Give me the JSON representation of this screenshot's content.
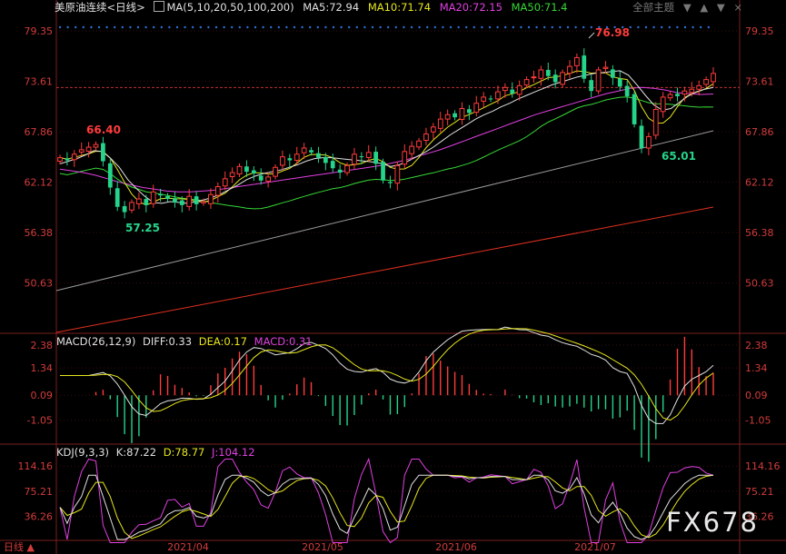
{
  "header": {
    "symbol": "美原油连续",
    "period": "<日线>",
    "ma_label": "MA(5,10,20,50,100,200)",
    "ma_values": [
      {
        "text": "MA5:72.94",
        "color": "#e0e0e0"
      },
      {
        "text": "MA10:71.74",
        "color": "#e6e61e"
      },
      {
        "text": "MA20:72.15",
        "color": "#e040e0"
      },
      {
        "text": "MA50:71.4",
        "color": "#36d836"
      }
    ],
    "controls": [
      "全部主题",
      "▼",
      "▲",
      "▼",
      "×"
    ]
  },
  "macd_header": {
    "label": "MACD(26,12,9)",
    "values": [
      {
        "text": "DIFF:0.33",
        "color": "#e0e0e0"
      },
      {
        "text": "DEA:0.17",
        "color": "#e6e61e"
      },
      {
        "text": "MACD:0.31",
        "color": "#e040e0"
      }
    ]
  },
  "kdj_header": {
    "label": "KDJ(9,3,3)",
    "values": [
      {
        "text": "K:87.22",
        "color": "#e0e0e0"
      },
      {
        "text": "D:78.77",
        "color": "#e6e61e"
      },
      {
        "text": "J:104.12",
        "color": "#e040e0"
      }
    ]
  },
  "price_axis": [
    "79.35",
    "73.61",
    "67.86",
    "62.12",
    "56.38",
    "50.63"
  ],
  "macd_axis": [
    "2.38",
    "1.34",
    "0.09",
    "-1.05"
  ],
  "kdj_axis": [
    "114.16",
    "75.21",
    "36.26"
  ],
  "x_axis": [
    "2021/04",
    "2021/05",
    "2021/06",
    "2021/07"
  ],
  "annotations": {
    "high": "76.98",
    "swing_high": "66.40",
    "low1": "57.25",
    "low2": "65.01"
  },
  "last_price": "73.61",
  "footer_label": "日线",
  "watermark": "FX678",
  "colors": {
    "up": "#ff3b3b",
    "down": "#25d48a",
    "bg": "#000000",
    "axis": "#d43b3b"
  },
  "chart_data": {
    "type": "candlestick",
    "title": "美原油连续 <日线>",
    "x_labels": [
      "2021/04",
      "2021/05",
      "2021/06",
      "2021/07"
    ],
    "ylim": [
      45.0,
      81.0
    ],
    "key_values": {
      "high": 76.98,
      "swing_high": 66.4,
      "low1": 57.25,
      "low2": 65.01,
      "last": 73.61
    },
    "closes": [
      64.9,
      64.6,
      65.3,
      65.8,
      66.1,
      66.4,
      64.5,
      61.5,
      59.3,
      58.7,
      59.8,
      60.2,
      59.5,
      61.0,
      60.6,
      60.2,
      59.8,
      59.5,
      60.5,
      59.6,
      59.9,
      60.7,
      61.6,
      62.5,
      63.2,
      63.9,
      63.3,
      63.1,
      62.3,
      62.7,
      63.8,
      65.0,
      64.6,
      65.3,
      66.0,
      65.5,
      64.9,
      64.3,
      63.7,
      63.2,
      64.0,
      65.3,
      65.0,
      65.5,
      64.2,
      62.3,
      62.0,
      64.0,
      65.6,
      66.2,
      66.8,
      67.6,
      68.4,
      69.3,
      69.8,
      69.5,
      70.5,
      70.0,
      71.1,
      71.8,
      71.6,
      72.4,
      72.9,
      72.2,
      73.1,
      73.8,
      74.1,
      74.9,
      74.2,
      73.5,
      74.6,
      75.3,
      76.3,
      73.9,
      72.5,
      74.9,
      75.2,
      74.0,
      73.0,
      71.9,
      68.7,
      66.0,
      67.3,
      70.4,
      71.8,
      72.1,
      71.9,
      72.5,
      72.7,
      73.1,
      73.8,
      74.5
    ],
    "ma5": [
      64.2,
      64.5,
      64.8,
      65.2,
      65.7,
      65.6,
      64.8,
      63.8,
      62.4,
      61.4,
      60.5,
      59.8,
      59.7,
      59.9,
      59.8,
      59.7,
      59.9,
      60.1,
      60.4,
      60.8,
      61.3,
      61.8,
      62.4,
      62.8,
      63.1,
      63.3,
      63.5,
      63.8,
      64.1,
      64.5,
      64.8,
      64.9,
      64.9,
      64.8,
      64.7,
      64.6,
      64.5,
      64.4,
      64.2,
      63.9,
      64.1,
      64.5,
      65.0,
      65.5,
      66.1,
      66.8,
      67.5,
      68.1,
      68.7,
      69.3,
      69.8,
      70.2,
      70.7,
      71.1,
      71.6,
      72.0,
      72.4,
      72.8,
      73.2,
      73.5,
      73.8,
      74.1,
      74.3,
      74.5,
      74.6,
      74.7,
      74.8,
      74.3,
      73.2,
      72.0,
      70.9,
      70.3,
      70.5,
      71.2,
      71.9,
      72.4,
      72.7,
      72.9
    ],
    "ma20": [
      63.6,
      63.4,
      63.2,
      62.9,
      62.5,
      62.1,
      61.8,
      61.5,
      61.3,
      61.1,
      61.0,
      61.0,
      61.1,
      61.2,
      61.4,
      61.6,
      61.8,
      62.0,
      62.2,
      62.4,
      62.6,
      62.8,
      63.0,
      63.2,
      63.4,
      63.6,
      63.8,
      64.0,
      64.3,
      64.6,
      65.0,
      65.4,
      65.8,
      66.3,
      66.8,
      67.3,
      67.8,
      68.3,
      68.8,
      69.3,
      69.8,
      70.2,
      70.6,
      71.0,
      71.4,
      71.8,
      72.2,
      72.5,
      72.8,
      72.9,
      72.8,
      72.6,
      72.3,
      72.2,
      72.1,
      72.15
    ]
  }
}
